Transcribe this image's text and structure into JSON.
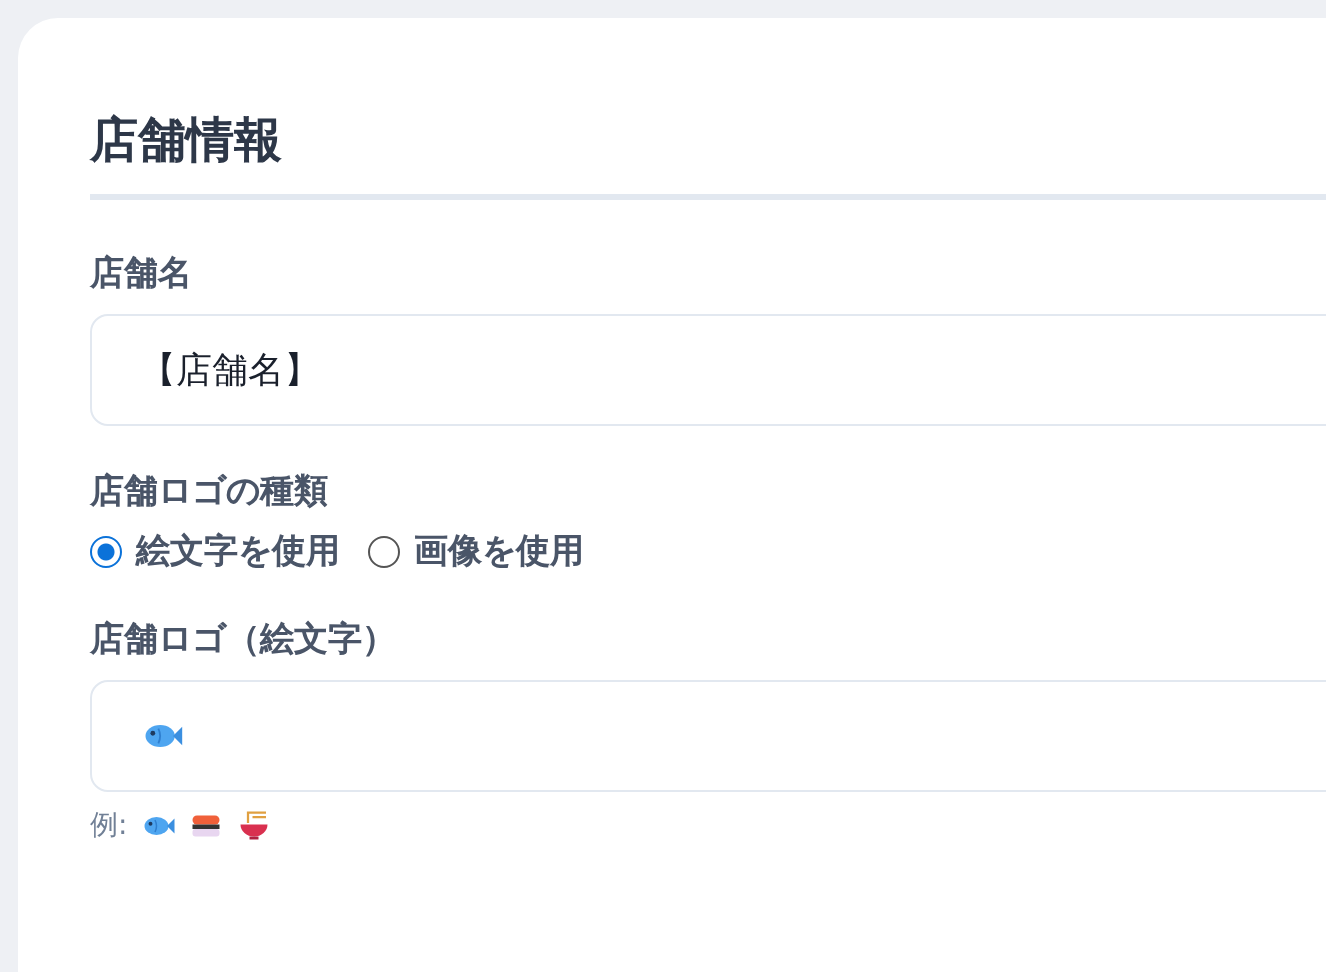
{
  "title": "店舗情報",
  "fields": [
    {
      "kind": "text",
      "label": "店舗名",
      "value": "【店舗名】"
    },
    {
      "kind": "radio",
      "label": "店舗ロゴの種類",
      "options": [
        {
          "label": "絵文字を使用",
          "selected": true
        },
        {
          "label": "画像を使用",
          "selected": false
        }
      ]
    },
    {
      "kind": "emoji",
      "label": "店舗ロゴ（絵文字）",
      "hint": "例:"
    }
  ]
}
